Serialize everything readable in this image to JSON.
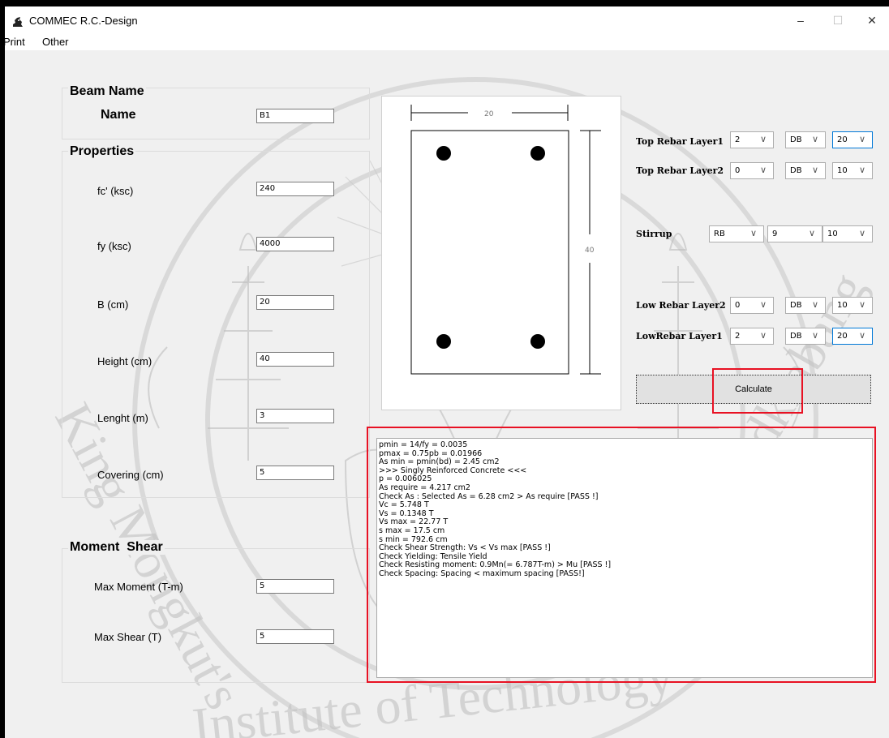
{
  "window": {
    "title": "COMMEC R.C.-Design",
    "minimize": "–",
    "maximize": "☐",
    "close": "✕"
  },
  "menu": [
    "Print",
    "Other"
  ],
  "beam_name": {
    "group_title": "Beam Name",
    "label": "Name",
    "value": "B1"
  },
  "properties": {
    "group_title": "Properties",
    "fields": [
      {
        "label": "fc' (ksc)",
        "value": "240"
      },
      {
        "label": "fy (ksc)",
        "value": "4000"
      },
      {
        "label": "B (cm)",
        "value": "20"
      },
      {
        "label": "Height (cm)",
        "value": "40"
      },
      {
        "label": "Lenght (m)",
        "value": "3"
      },
      {
        "label": "Covering (cm)",
        "value": "5"
      }
    ]
  },
  "moment_shear": {
    "group_title": "Moment  Shear",
    "fields": [
      {
        "label": "Max Moment (T-m)",
        "value": "5"
      },
      {
        "label": "Max Shear (T)",
        "value": "5"
      }
    ]
  },
  "section": {
    "width_dim": "20",
    "height_dim": "40"
  },
  "rebar": {
    "top1": {
      "label": "Top Rebar Layer1",
      "count": "2",
      "type": "DB",
      "size": "20"
    },
    "top2": {
      "label": "Top Rebar Layer2",
      "count": "0",
      "type": "DB",
      "size": "10"
    },
    "stirrup": {
      "label": "Stirrup",
      "type": "RB",
      "dia": "9",
      "spacing": "10"
    },
    "low2": {
      "label": "Low Rebar Layer2",
      "count": "0",
      "type": "DB",
      "size": "10"
    },
    "low1": {
      "label": "LowRebar Layer1",
      "count": "2",
      "type": "DB",
      "size": "20"
    }
  },
  "calculate_label": "Calculate",
  "output_lines": [
    "pmin = 14/fy = 0.0035",
    "pmax = 0.75pb = 0.01966",
    "As min = pmin(bd) = 2.45 cm2",
    ">>> Singly Reinforced Concrete <<<",
    "p = 0.006025",
    "As require = 4.217 cm2",
    "Check As : Selected As = 6.28 cm2 > As require [PASS !]",
    "Vc = 5.748 T",
    "Vs = 0.1348 T",
    "Vs max = 22.77 T",
    "s max = 17.5 cm",
    "s min = 792.6 cm",
    "Check Shear Strength: Vs < Vs max [PASS !]",
    "Check Yielding: Tensile Yield",
    "Check Resisting moment: 0.9Mn(= 6.787T-m) > Mu [PASS !]",
    "Check Spacing: Spacing < maximum spacing [PASS!]"
  ],
  "watermark": {
    "text_left": "King Mongkut's",
    "text_bottom": "Institute of Technology",
    "text_right": "Ladkrabang"
  },
  "colors": {
    "highlight_red": "#e81123",
    "focus_blue": "#0078d7",
    "window_bg": "#f0f0f0"
  }
}
